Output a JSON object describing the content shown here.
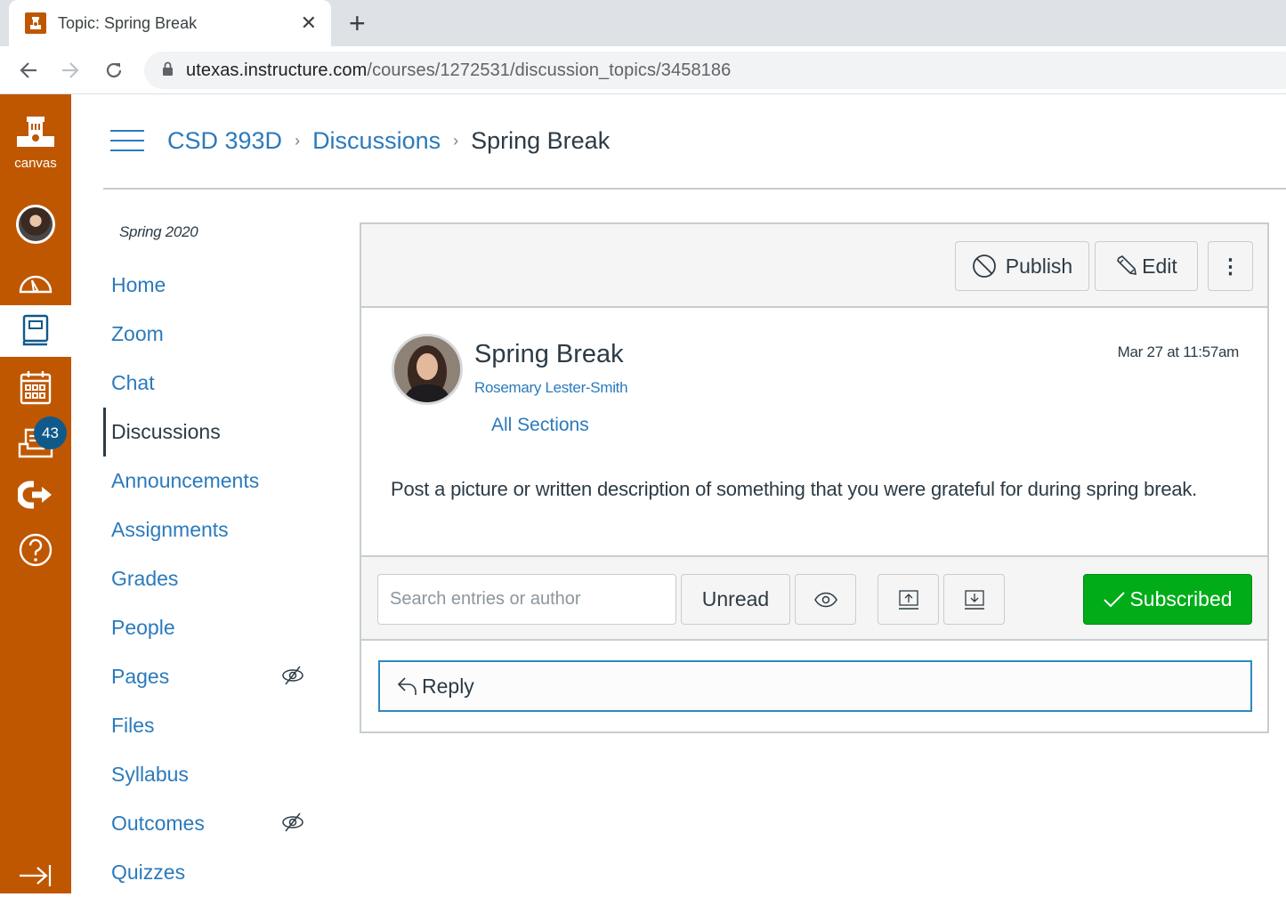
{
  "browser": {
    "tab_title": "Topic: Spring Break",
    "url_host": "utexas.instructure.com",
    "url_path": "/courses/1272531/discussion_topics/3458186"
  },
  "global_nav": {
    "logo_label": "canvas",
    "items": [
      {
        "name": "account",
        "icon": "user-avatar"
      },
      {
        "name": "dashboard",
        "icon": "dashboard-gauge-icon"
      },
      {
        "name": "courses",
        "icon": "book-icon",
        "active": true
      },
      {
        "name": "calendar",
        "icon": "calendar-icon"
      },
      {
        "name": "inbox",
        "icon": "inbox-icon",
        "badge": "43"
      },
      {
        "name": "commons",
        "icon": "commons-arrow-icon"
      },
      {
        "name": "help",
        "icon": "help-icon"
      }
    ],
    "collapse_icon": "collapse-arrow-icon",
    "brand_color": "#bf5700"
  },
  "breadcrumb": {
    "course": "CSD 393D",
    "section": "Discussions",
    "current": "Spring Break"
  },
  "course_nav": {
    "term": "Spring 2020",
    "items": [
      {
        "label": "Home"
      },
      {
        "label": "Zoom"
      },
      {
        "label": "Chat"
      },
      {
        "label": "Discussions",
        "active": true
      },
      {
        "label": "Announcements"
      },
      {
        "label": "Assignments"
      },
      {
        "label": "Grades"
      },
      {
        "label": "People"
      },
      {
        "label": "Pages",
        "hidden_from_students": true
      },
      {
        "label": "Files"
      },
      {
        "label": "Syllabus"
      },
      {
        "label": "Outcomes",
        "hidden_from_students": true
      },
      {
        "label": "Quizzes"
      }
    ]
  },
  "toolbar": {
    "publish_label": "Publish",
    "edit_label": "Edit",
    "more_label": "⋮"
  },
  "discussion": {
    "title": "Spring Break",
    "author": "Rosemary Lester-Smith",
    "sections": "All Sections",
    "date": "Mar 27 at 11:57am",
    "body": "Post a picture or written description of something that you were grateful for during spring break."
  },
  "filters": {
    "search_placeholder": "Search entries or author",
    "search_value": "",
    "unread_label": "Unread",
    "subscribed_label": "Subscribed",
    "subscribed_color": "#00ac18"
  },
  "reply": {
    "label": "Reply"
  },
  "colors": {
    "link": "#2b7abc",
    "text": "#2d3b45"
  }
}
